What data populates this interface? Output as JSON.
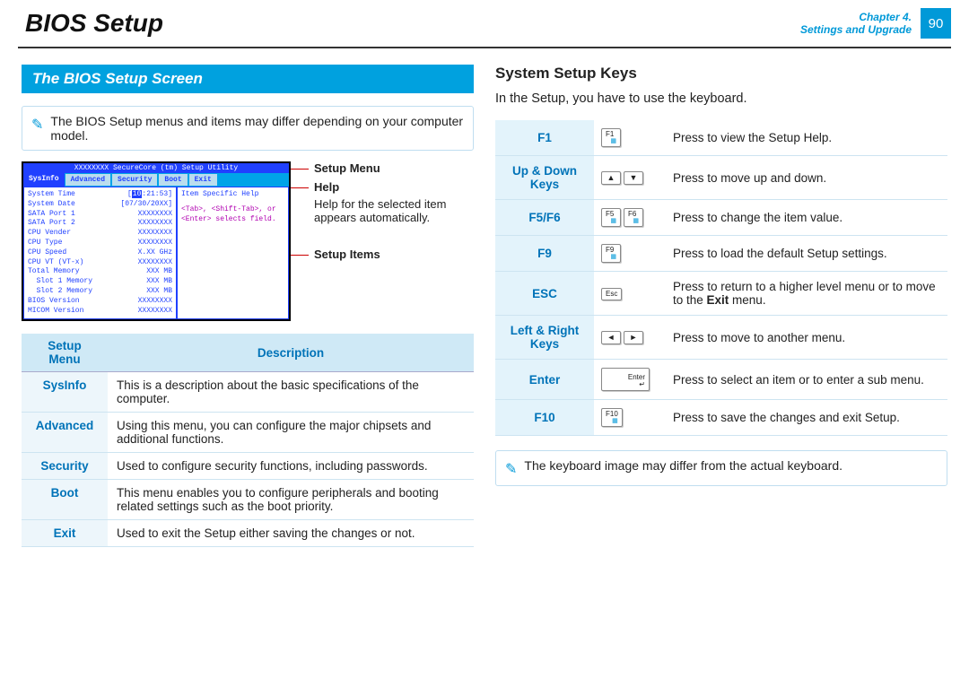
{
  "header": {
    "title": "BIOS Setup",
    "chapter_line1": "Chapter 4.",
    "chapter_line2": "Settings and Upgrade",
    "page_number": "90"
  },
  "left": {
    "section_title": "The BIOS Setup Screen",
    "note": "The BIOS Setup menus and items may differ depending on your computer model.",
    "bios": {
      "topbar": "XXXXXXXX SecureCore (tm) Setup Utility",
      "tabs": [
        "SysInfo",
        "Advanced",
        "Security",
        "Boot",
        "Exit"
      ],
      "rows": [
        {
          "k": "System Time",
          "v": "[10:21:53]",
          "hl": "10"
        },
        {
          "k": "System Date",
          "v": "[07/30/20XX]"
        },
        {
          "k": "",
          "v": ""
        },
        {
          "k": "SATA Port 1",
          "v": "XXXXXXXX"
        },
        {
          "k": "SATA Port 2",
          "v": "XXXXXXXX"
        },
        {
          "k": "",
          "v": ""
        },
        {
          "k": "CPU Vender",
          "v": "XXXXXXXX"
        },
        {
          "k": "CPU Type",
          "v": "XXXXXXXX"
        },
        {
          "k": "CPU Speed",
          "v": "X.XX GHz"
        },
        {
          "k": "CPU VT (VT-x)",
          "v": "XXXXXXXX"
        },
        {
          "k": "",
          "v": ""
        },
        {
          "k": "Total Memory",
          "v": "XXX MB"
        },
        {
          "k": "  Slot 1 Memory",
          "v": "XXX MB"
        },
        {
          "k": "  Slot 2 Memory",
          "v": "XXX MB"
        },
        {
          "k": "",
          "v": ""
        },
        {
          "k": "BIOS Version",
          "v": "XXXXXXXX"
        },
        {
          "k": "MICOM Version",
          "v": "XXXXXXXX"
        }
      ],
      "help_title": "Item Specific Help",
      "help_body": "<Tab>, <Shift-Tab>, or <Enter> selects field."
    },
    "figure_labels": {
      "menu": "Setup Menu",
      "help": "Help",
      "help_text": "Help for the selected item appears automatically.",
      "items": "Setup Items"
    },
    "menu_table": {
      "h1": "Setup Menu",
      "h2": "Description",
      "rows": [
        {
          "name": "SysInfo",
          "desc": "This is a description about the basic specifications of the computer."
        },
        {
          "name": "Advanced",
          "desc": "Using this menu, you can configure the major chipsets and additional functions."
        },
        {
          "name": "Security",
          "desc": "Used to configure security functions, including passwords."
        },
        {
          "name": "Boot",
          "desc": "This menu enables you to configure peripherals and booting related settings such as the boot priority."
        },
        {
          "name": "Exit",
          "desc": "Used to exit the Setup either saving the changes or not."
        }
      ]
    }
  },
  "right": {
    "heading": "System Setup Keys",
    "intro": "In the Setup, you have to use the keyboard.",
    "keys": [
      {
        "name": "F1",
        "cap": [
          "F1"
        ],
        "desc": "Press to view the Setup Help."
      },
      {
        "name": "Up & Down Keys",
        "cap": [
          "▲",
          "▼"
        ],
        "desc": "Press to move up and down."
      },
      {
        "name": "F5/F6",
        "cap": [
          "F5",
          "F6"
        ],
        "desc": "Press to change the item value."
      },
      {
        "name": "F9",
        "cap": [
          "F9"
        ],
        "desc": "Press to load the default Setup settings."
      },
      {
        "name": "ESC",
        "cap": [
          "Esc"
        ],
        "desc_html": "Press to return to a higher level menu or to move to the <b>Exit</b> menu."
      },
      {
        "name": "Left & Right Keys",
        "cap": [
          "◄",
          "►"
        ],
        "desc": "Press to move to another menu."
      },
      {
        "name": "Enter",
        "cap": [
          "Enter↵"
        ],
        "wide": true,
        "desc": "Press to select an item or to enter a sub menu."
      },
      {
        "name": "F10",
        "cap": [
          "F10"
        ],
        "desc": "Press to save the changes and exit Setup."
      }
    ],
    "note": "The keyboard image may differ from the actual keyboard."
  }
}
